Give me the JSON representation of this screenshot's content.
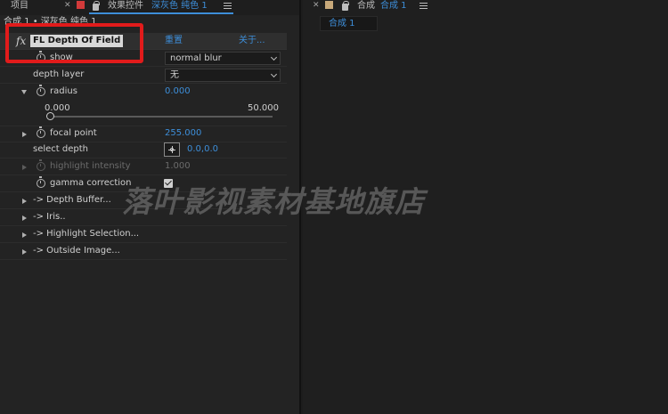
{
  "left_panel": {
    "tabs": {
      "project_label": "项目",
      "effect_controls_label": "效果控件",
      "effect_controls_layer": "深灰色 纯色 1"
    },
    "breadcrumb": "合成 1 • 深灰色 纯色 1",
    "effect": {
      "name": "FL Depth Of Field",
      "reset_label": "重置",
      "about_label": "关于..."
    },
    "properties": [
      {
        "label": "show",
        "value": "normal blur"
      },
      {
        "label": "depth layer",
        "value": "无"
      },
      {
        "label": "radius",
        "value": "0.000",
        "range_min": "0.000",
        "range_max": "50.000",
        "slider_fraction": 0
      },
      {
        "label": "focal point",
        "value": "255.000"
      },
      {
        "label": "select depth",
        "value": "0.0,0.0"
      },
      {
        "label": "highlight intensity",
        "value": "1.000"
      },
      {
        "label": "gamma correction",
        "checked": true
      }
    ],
    "groups": [
      "-> Depth Buffer...",
      "-> Iris..",
      "-> Highlight Selection...",
      "-> Outside Image..."
    ]
  },
  "right_panel": {
    "tab_prefix": "合成",
    "tab_label": "合成 1",
    "comp_tab": "合成 1"
  },
  "watermark": "落叶影视素材基地旗店",
  "colors": {
    "accent": "#3d8ed9",
    "highlight_box": "#e11b1b",
    "panel_bg": "#232323"
  },
  "icons": [
    "close-icon",
    "lock-icon",
    "menu-icon",
    "stopwatch-icon",
    "crosshair-icon",
    "checkbox-icon",
    "fx-icon"
  ]
}
